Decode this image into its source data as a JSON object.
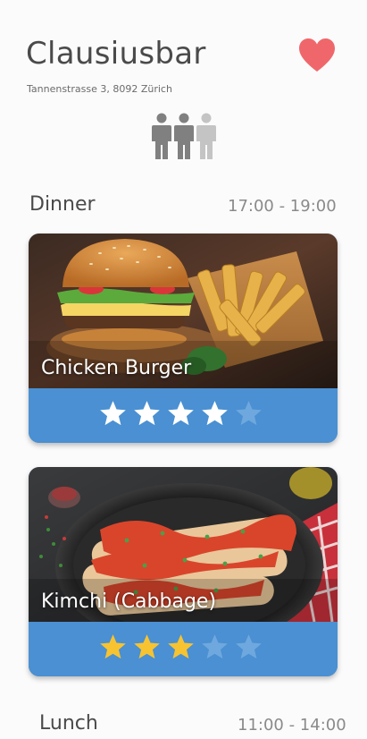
{
  "restaurant": {
    "name": "Clausiusbar",
    "address": "Tannenstrasse 3, 8092 Zürich",
    "favorite": true,
    "occupancy": {
      "filled": 2,
      "total": 3
    }
  },
  "sections": [
    {
      "name": "Dinner",
      "time": "17:00 - 19:00",
      "dishes": [
        {
          "name": "Chicken Burger",
          "rating": 4,
          "max_rating": 5
        },
        {
          "name": "Kimchi (Cabbage)",
          "rating": 3,
          "max_rating": 5
        }
      ]
    },
    {
      "name": "Lunch",
      "time": "11:00 - 14:00",
      "dishes": []
    }
  ],
  "colors": {
    "accent_blue": "#4a90d2",
    "heart_red": "#f0676b",
    "star_white": "#ffffff",
    "star_yellow": "#f7c331",
    "star_empty": "#6fa8de"
  },
  "icons": {
    "favorite": "heart-icon",
    "occupancy": "people-icon",
    "rating": "star-icon"
  }
}
